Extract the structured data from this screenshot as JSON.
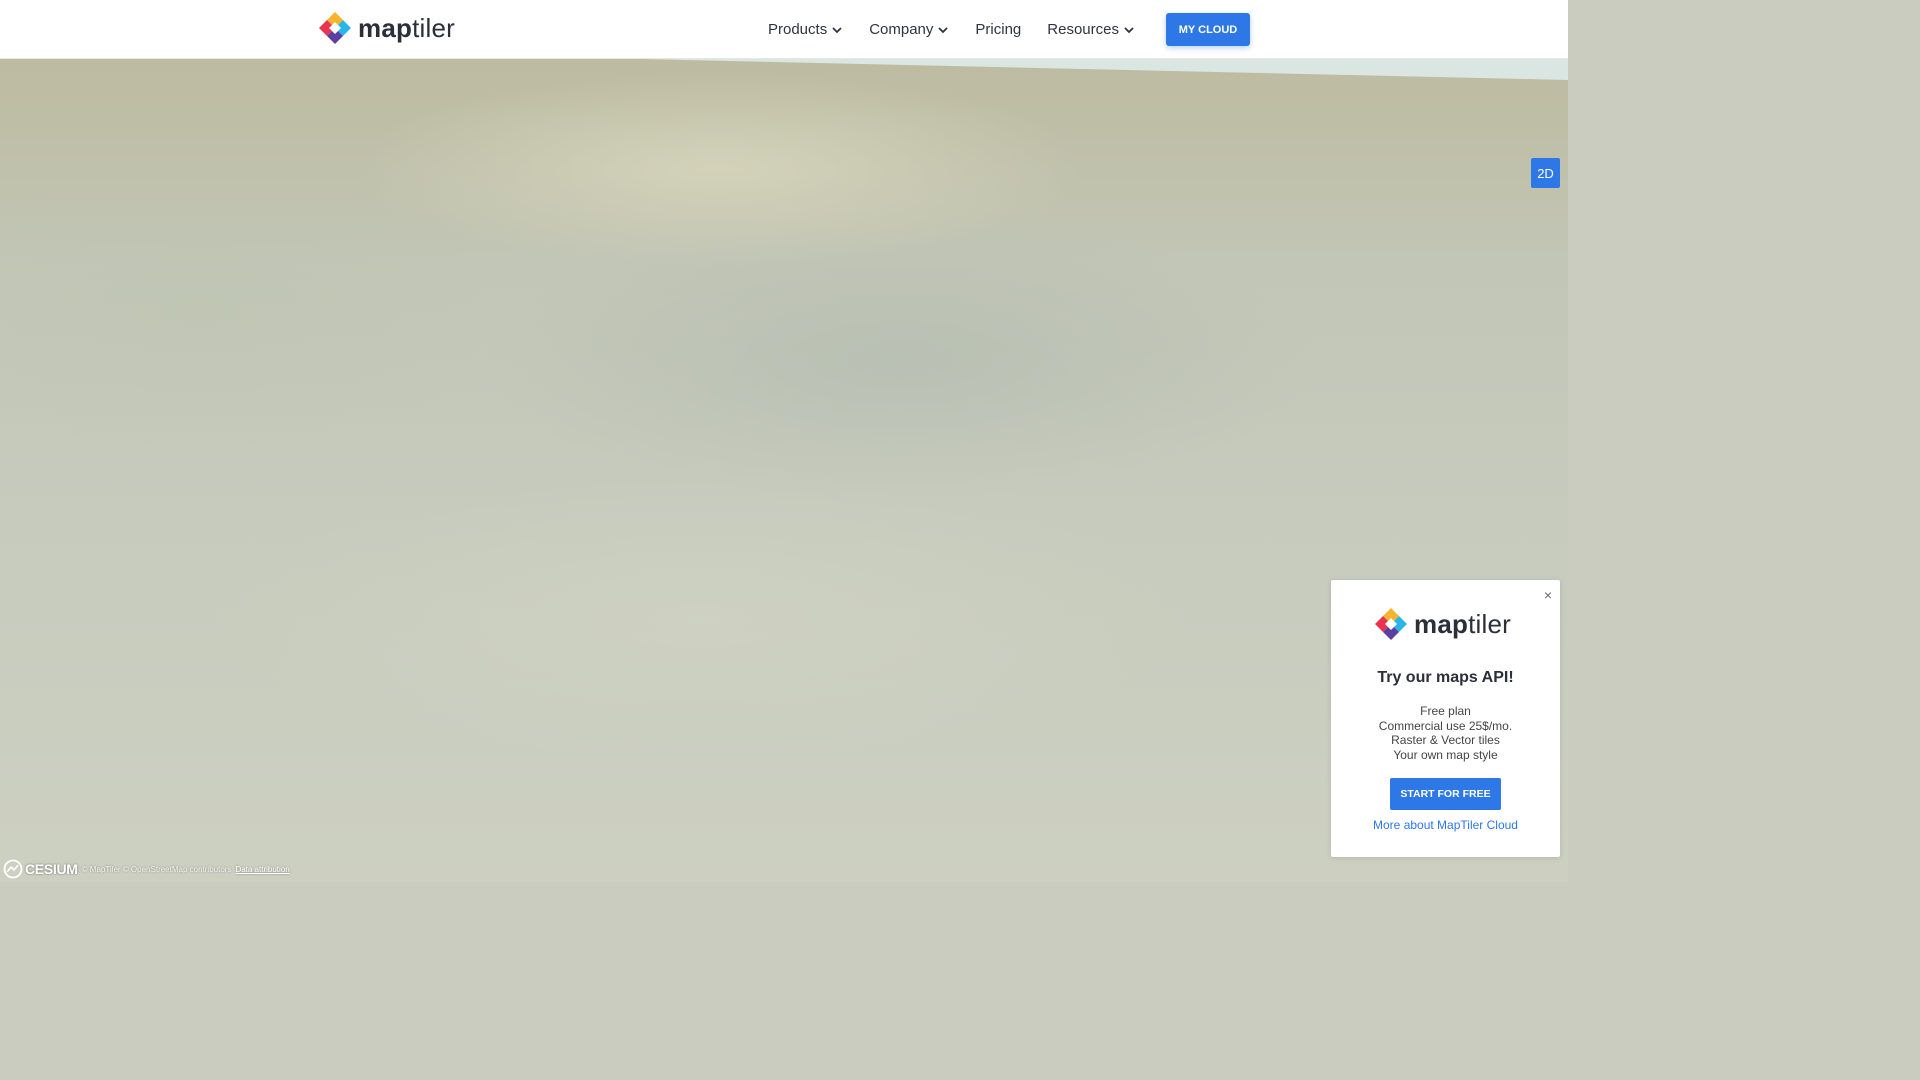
{
  "header": {
    "logo": {
      "bold": "map",
      "light": "tiler"
    },
    "nav": [
      {
        "label": "Products",
        "dropdown": true
      },
      {
        "label": "Company",
        "dropdown": true
      },
      {
        "label": "Pricing",
        "dropdown": false
      },
      {
        "label": "Resources",
        "dropdown": true
      }
    ],
    "cta_label": "MY CLOUD"
  },
  "map": {
    "mode_toggle_label": "2D",
    "attribution": {
      "engine": "CESIUM",
      "text": "© MapTiler © OpenStreetMap contributors",
      "link": "Data attribution"
    }
  },
  "popup": {
    "close": "×",
    "logo": {
      "bold": "map",
      "light": "tiler"
    },
    "title": "Try our maps API!",
    "lines": [
      "Free plan",
      "Commercial use 25$/mo.",
      "Raster & Vector tiles",
      "Your own map style"
    ],
    "button": "START FOR FREE",
    "link": "More about MapTiler Cloud"
  },
  "colors": {
    "accent": "#2d78e6",
    "text_dark": "#2b2f3a"
  }
}
